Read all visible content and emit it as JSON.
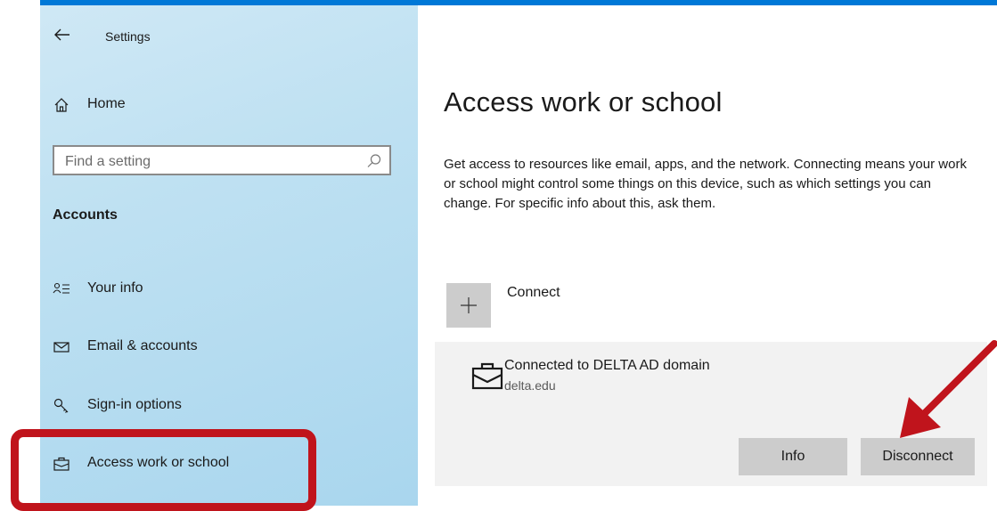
{
  "window": {
    "title": "Settings"
  },
  "sidebar": {
    "home_label": "Home",
    "search_placeholder": "Find a setting",
    "section_header": "Accounts",
    "items": [
      {
        "label": "Your info",
        "icon": "person-list-icon"
      },
      {
        "label": "Email & accounts",
        "icon": "mail-icon"
      },
      {
        "label": "Sign-in options",
        "icon": "key-icon"
      },
      {
        "label": "Access work or school",
        "icon": "briefcase-icon"
      }
    ]
  },
  "main": {
    "title": "Access work or school",
    "description": "Get access to resources like email, apps, and the network. Connecting means your work or school might control some things on this device, such as which settings you can change. For specific info about this, ask them.",
    "connect_label": "Connect",
    "account": {
      "name": "Connected to DELTA AD domain",
      "domain": "delta.edu",
      "info_button": "Info",
      "disconnect_button": "Disconnect"
    }
  },
  "colors": {
    "accent_bar": "#0078d7",
    "annotation_red": "#c0141c",
    "button_gray": "#cccccc",
    "card_gray": "#f2f2f2"
  }
}
